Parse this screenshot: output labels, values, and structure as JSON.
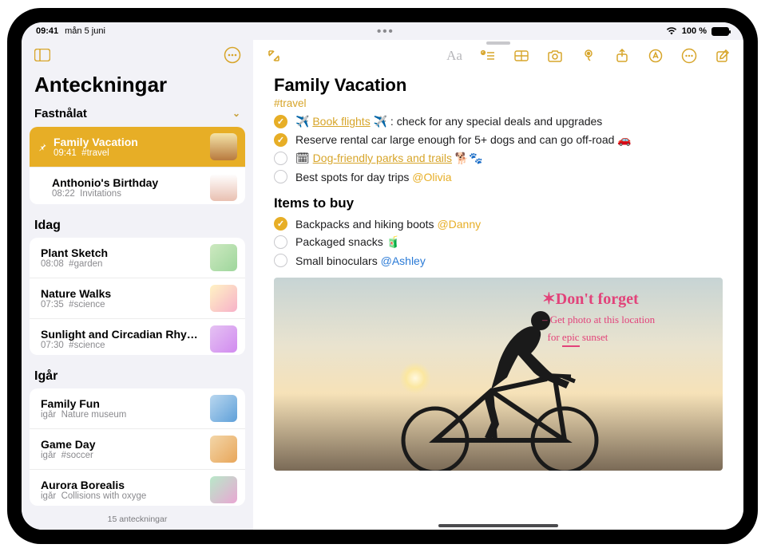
{
  "statusbar": {
    "time": "09:41",
    "date": "mån 5 juni",
    "battery_pct": "100 %"
  },
  "sidebar": {
    "title": "Anteckningar",
    "pinned_header": "Fastnålat",
    "today_header": "Idag",
    "yesterday_header": "Igår",
    "footer": "15 anteckningar",
    "pinned": [
      {
        "title": "Family Vacation",
        "time": "09:41",
        "meta": "#travel",
        "selected": true
      },
      {
        "title": "Anthonio's Birthday",
        "time": "08:22",
        "meta": "Invitations",
        "selected": false
      }
    ],
    "today": [
      {
        "title": "Plant Sketch",
        "time": "08:08",
        "meta": "#garden"
      },
      {
        "title": "Nature Walks",
        "time": "07:35",
        "meta": "#science"
      },
      {
        "title": "Sunlight and Circadian Rhy…",
        "time": "07:30",
        "meta": "#science"
      }
    ],
    "yesterday": [
      {
        "title": "Family Fun",
        "time": "igår",
        "meta": "Nature museum"
      },
      {
        "title": "Game Day",
        "time": "igår",
        "meta": "#soccer"
      },
      {
        "title": "Aurora Borealis",
        "time": "igår",
        "meta": "Collisions with oxyge"
      }
    ]
  },
  "note": {
    "title": "Family Vacation",
    "tag": "#travel",
    "list1": [
      {
        "checked": true,
        "pre_emoji": "✈️",
        "link_text": "Book flights",
        "post_emoji": "✈️",
        "rest": ": check for any special deals and upgrades"
      },
      {
        "checked": true,
        "text": "Reserve rental car large enough for 5+ dogs and can go off-road ",
        "post_emoji": "🚗"
      },
      {
        "checked": false,
        "pre_emoji": "🗓",
        "link_text": "Dog-friendly parks and trails",
        "post_emoji": " 🐕🐾"
      },
      {
        "checked": false,
        "text": "Best spots for day trips ",
        "mention": "@Olivia"
      }
    ],
    "section2_title": "Items to buy",
    "list2": [
      {
        "checked": true,
        "text": "Backpacks and hiking boots ",
        "mention": "@Danny"
      },
      {
        "checked": false,
        "text": "Packaged snacks ",
        "post_emoji": "🧃"
      },
      {
        "checked": false,
        "text": "Small binoculars ",
        "mention": "@Ashley",
        "mention_blue": true
      }
    ],
    "handwriting": {
      "title": "Don't forget",
      "sub1": "– Get photo at this location",
      "sub2_a": "for ",
      "sub2_b": "epic",
      "sub2_c": " sunset"
    }
  }
}
